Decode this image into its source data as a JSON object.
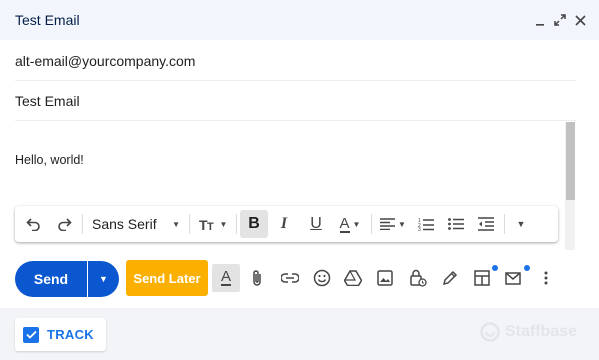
{
  "window": {
    "title": "Test Email",
    "controls": [
      "minimize-icon",
      "expand-icon",
      "close-icon"
    ]
  },
  "compose": {
    "to": "alt-email@yourcompany.com",
    "subject": "Test Email",
    "body": "Hello, world!"
  },
  "format_toolbar": {
    "font_family": "Sans Serif",
    "buttons": [
      "undo-icon",
      "redo-icon",
      "text-size-icon",
      "bold-icon",
      "italic-icon",
      "underline-icon",
      "text-color-icon",
      "align-icon",
      "numbered-list-icon",
      "bulleted-list-icon",
      "indent-less-icon",
      "more-formatting-icon"
    ],
    "bold_active": true
  },
  "actions": {
    "send_label": "Send",
    "send_later_label": "Send Later",
    "send_later_color": "#fbb000",
    "send_color": "#0b57d0"
  },
  "footer": {
    "track_label": "TRACK",
    "track_checked": true,
    "brand": "Staffbase"
  }
}
